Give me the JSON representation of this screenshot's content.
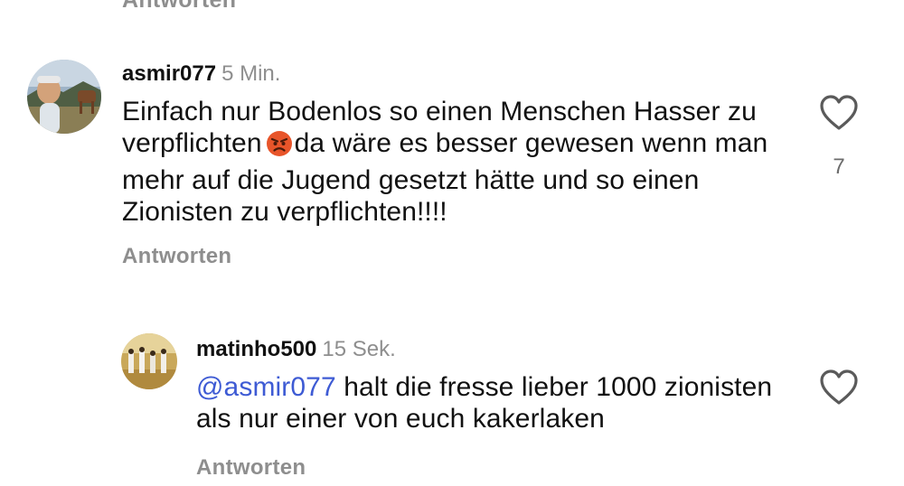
{
  "previous": {
    "reply_label": "Antworten"
  },
  "comments": [
    {
      "username": "asmir077",
      "timestamp": "5 Min.",
      "text_before_emoji": "Einfach nur Bodenlos so einen Menschen Hasser zu verpflichten",
      "emoji": "angry-face-emoji",
      "text_after_emoji": "da wäre es besser gewesen wenn man mehr auf die Jugend gesetzt hätte und so einen Zionisten zu verpflichten!!!!",
      "like_count": "7",
      "reply_label": "Antworten"
    },
    {
      "username": "matinho500",
      "timestamp": "15 Sek.",
      "mention": "@asmir077",
      "text": "halt die fresse lieber 1000 zionisten als nur einer von euch kakerlaken",
      "reply_label": "Antworten"
    }
  ],
  "colors": {
    "text": "#111111",
    "muted": "#8e8e8e",
    "mention": "#3e5bd4",
    "heart_outline": "#5a5a5a",
    "emoji_fill": "#e8552a"
  }
}
